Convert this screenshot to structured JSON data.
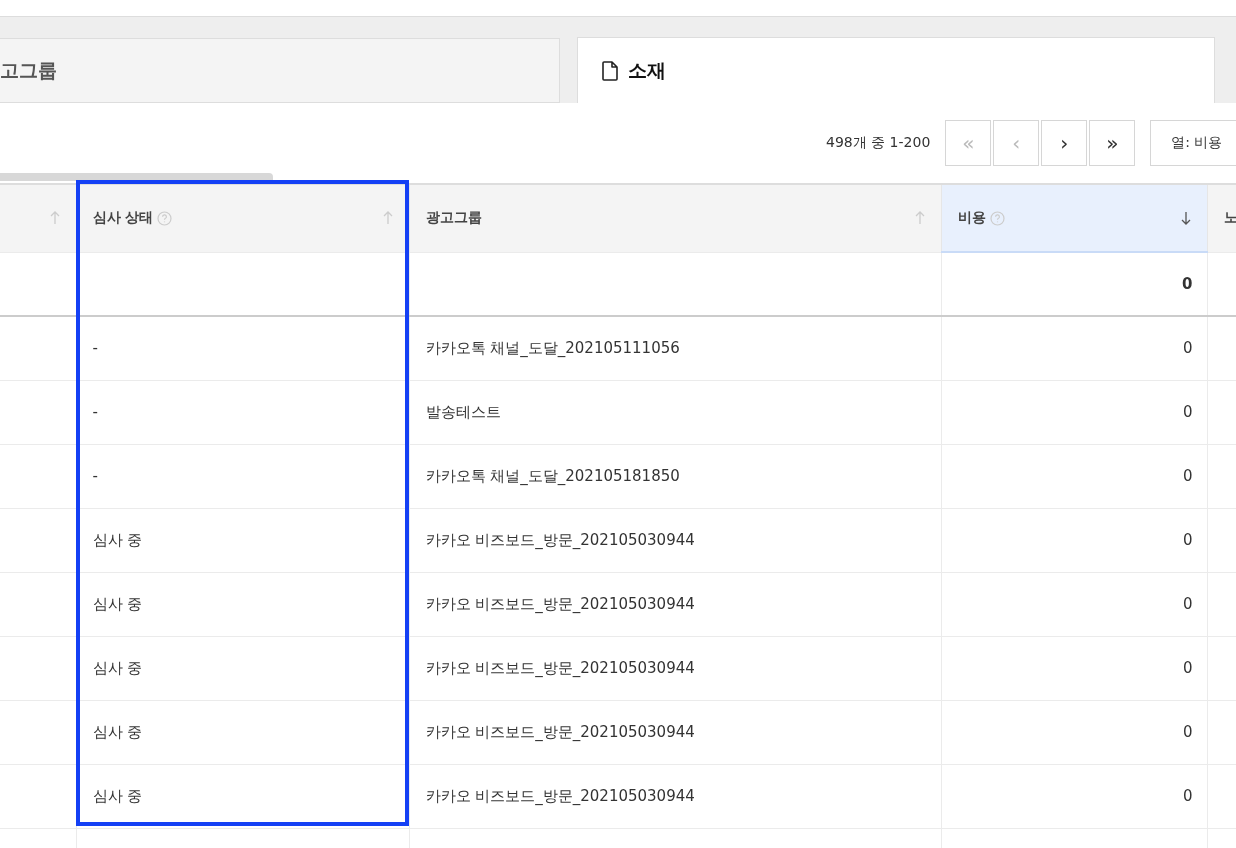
{
  "tabs": [
    {
      "label": "고그룹",
      "selected": false
    },
    {
      "label": "소재",
      "selected": true
    }
  ],
  "pagination": {
    "summary": "498개 중 1-200",
    "buttons": [
      {
        "label": "«",
        "disabled": true
      },
      {
        "label": "‹",
        "disabled": true
      },
      {
        "label": "›",
        "disabled": false
      },
      {
        "label": "»",
        "disabled": false
      }
    ]
  },
  "column_button": {
    "label": "열: 비용"
  },
  "table": {
    "columns": [
      {
        "sortable": true,
        "selected": false
      },
      {
        "label": "심사 상태",
        "help": true,
        "sortable": true,
        "selected": false
      },
      {
        "label": "광고그룹",
        "sortable": true,
        "selected": false
      },
      {
        "label": "비용",
        "help": true,
        "sortable": true,
        "selected": true
      },
      {
        "label": "노",
        "selected": false
      }
    ],
    "summary": {
      "cost": "0"
    },
    "rows": [
      {
        "review_status": "-",
        "ad_group": "카카오톡 채널_도달_202105111056",
        "cost": "0"
      },
      {
        "review_status": "-",
        "ad_group": "발송테스트",
        "cost": "0"
      },
      {
        "review_status": "-",
        "ad_group": "카카오톡 채널_도달_202105181850",
        "cost": "0"
      },
      {
        "review_status": "심사 중",
        "ad_group": "카카오 비즈보드_방문_202105030944",
        "cost": "0"
      },
      {
        "review_status": "심사 중",
        "ad_group": "카카오 비즈보드_방문_202105030944",
        "cost": "0"
      },
      {
        "review_status": "심사 중",
        "ad_group": "카카오 비즈보드_방문_202105030944",
        "cost": "0"
      },
      {
        "review_status": "심사 중",
        "ad_group": "카카오 비즈보드_방문_202105030944",
        "cost": "0"
      },
      {
        "review_status": "심사 중",
        "ad_group": "카카오 비즈보드_방문_202105030944",
        "cost": "0"
      }
    ]
  }
}
